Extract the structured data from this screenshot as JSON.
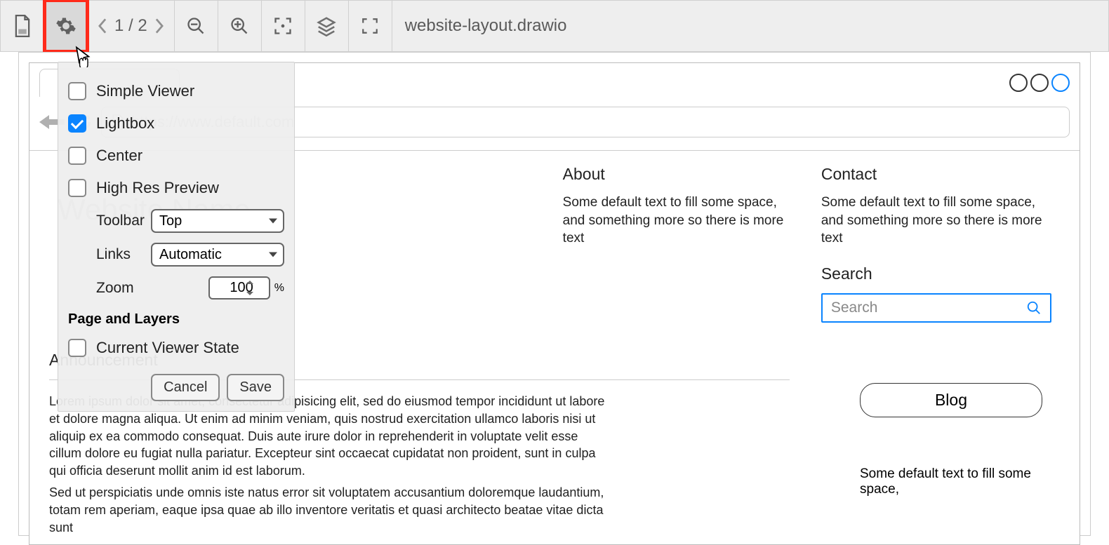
{
  "toolbar": {
    "page_indicator": "1 / 2",
    "filename": "website-layout.drawio"
  },
  "settings": {
    "simple_viewer": {
      "label": "Simple Viewer",
      "checked": false
    },
    "lightbox": {
      "label": "Lightbox",
      "checked": true
    },
    "center": {
      "label": "Center",
      "checked": false
    },
    "high_res": {
      "label": "High Res Preview",
      "checked": false
    },
    "toolbar_label": "Toolbar",
    "toolbar_value": "Top",
    "links_label": "Links",
    "links_value": "Automatic",
    "zoom_label": "Zoom",
    "zoom_value": "100",
    "zoom_suffix": "%",
    "page_layers_title": "Page and Layers",
    "current_viewer_state": {
      "label": "Current Viewer State",
      "checked": false
    },
    "cancel": "Cancel",
    "save": "Save"
  },
  "mockup": {
    "url": "https://www.default.com",
    "site_name": "Website Name",
    "about": {
      "title": "About",
      "body": "Some default text to fill some space, and something more so there is more text"
    },
    "contact": {
      "title": "Contact",
      "body": "Some default text to fill some space, and something more so there is more text"
    },
    "search_title": "Search",
    "search_placeholder": "Search",
    "announcement_title": "Announcement",
    "lorem1": "Lorem ipsum dolor sit amet, consectetur adipisicing elit, sed do eiusmod tempor incididunt ut labore et dolore magna aliqua. Ut enim ad minim veniam, quis nostrud exercitation ullamco laboris nisi ut aliquip ex ea commodo consequat. Duis aute irure dolor in reprehenderit in voluptate velit esse cillum dolore eu fugiat nulla pariatur. Excepteur sint occaecat cupidatat non proident, sunt in culpa qui officia deserunt mollit anim id est laborum.",
    "lorem2": "Sed ut perspiciatis unde omnis iste natus error sit voluptatem accusantium doloremque laudantium, totam rem aperiam, eaque ipsa quae ab illo inventore veritatis et quasi architecto beatae vitae dicta sunt",
    "blog_button": "Blog",
    "blog_text": "Some default text to fill some space,"
  }
}
